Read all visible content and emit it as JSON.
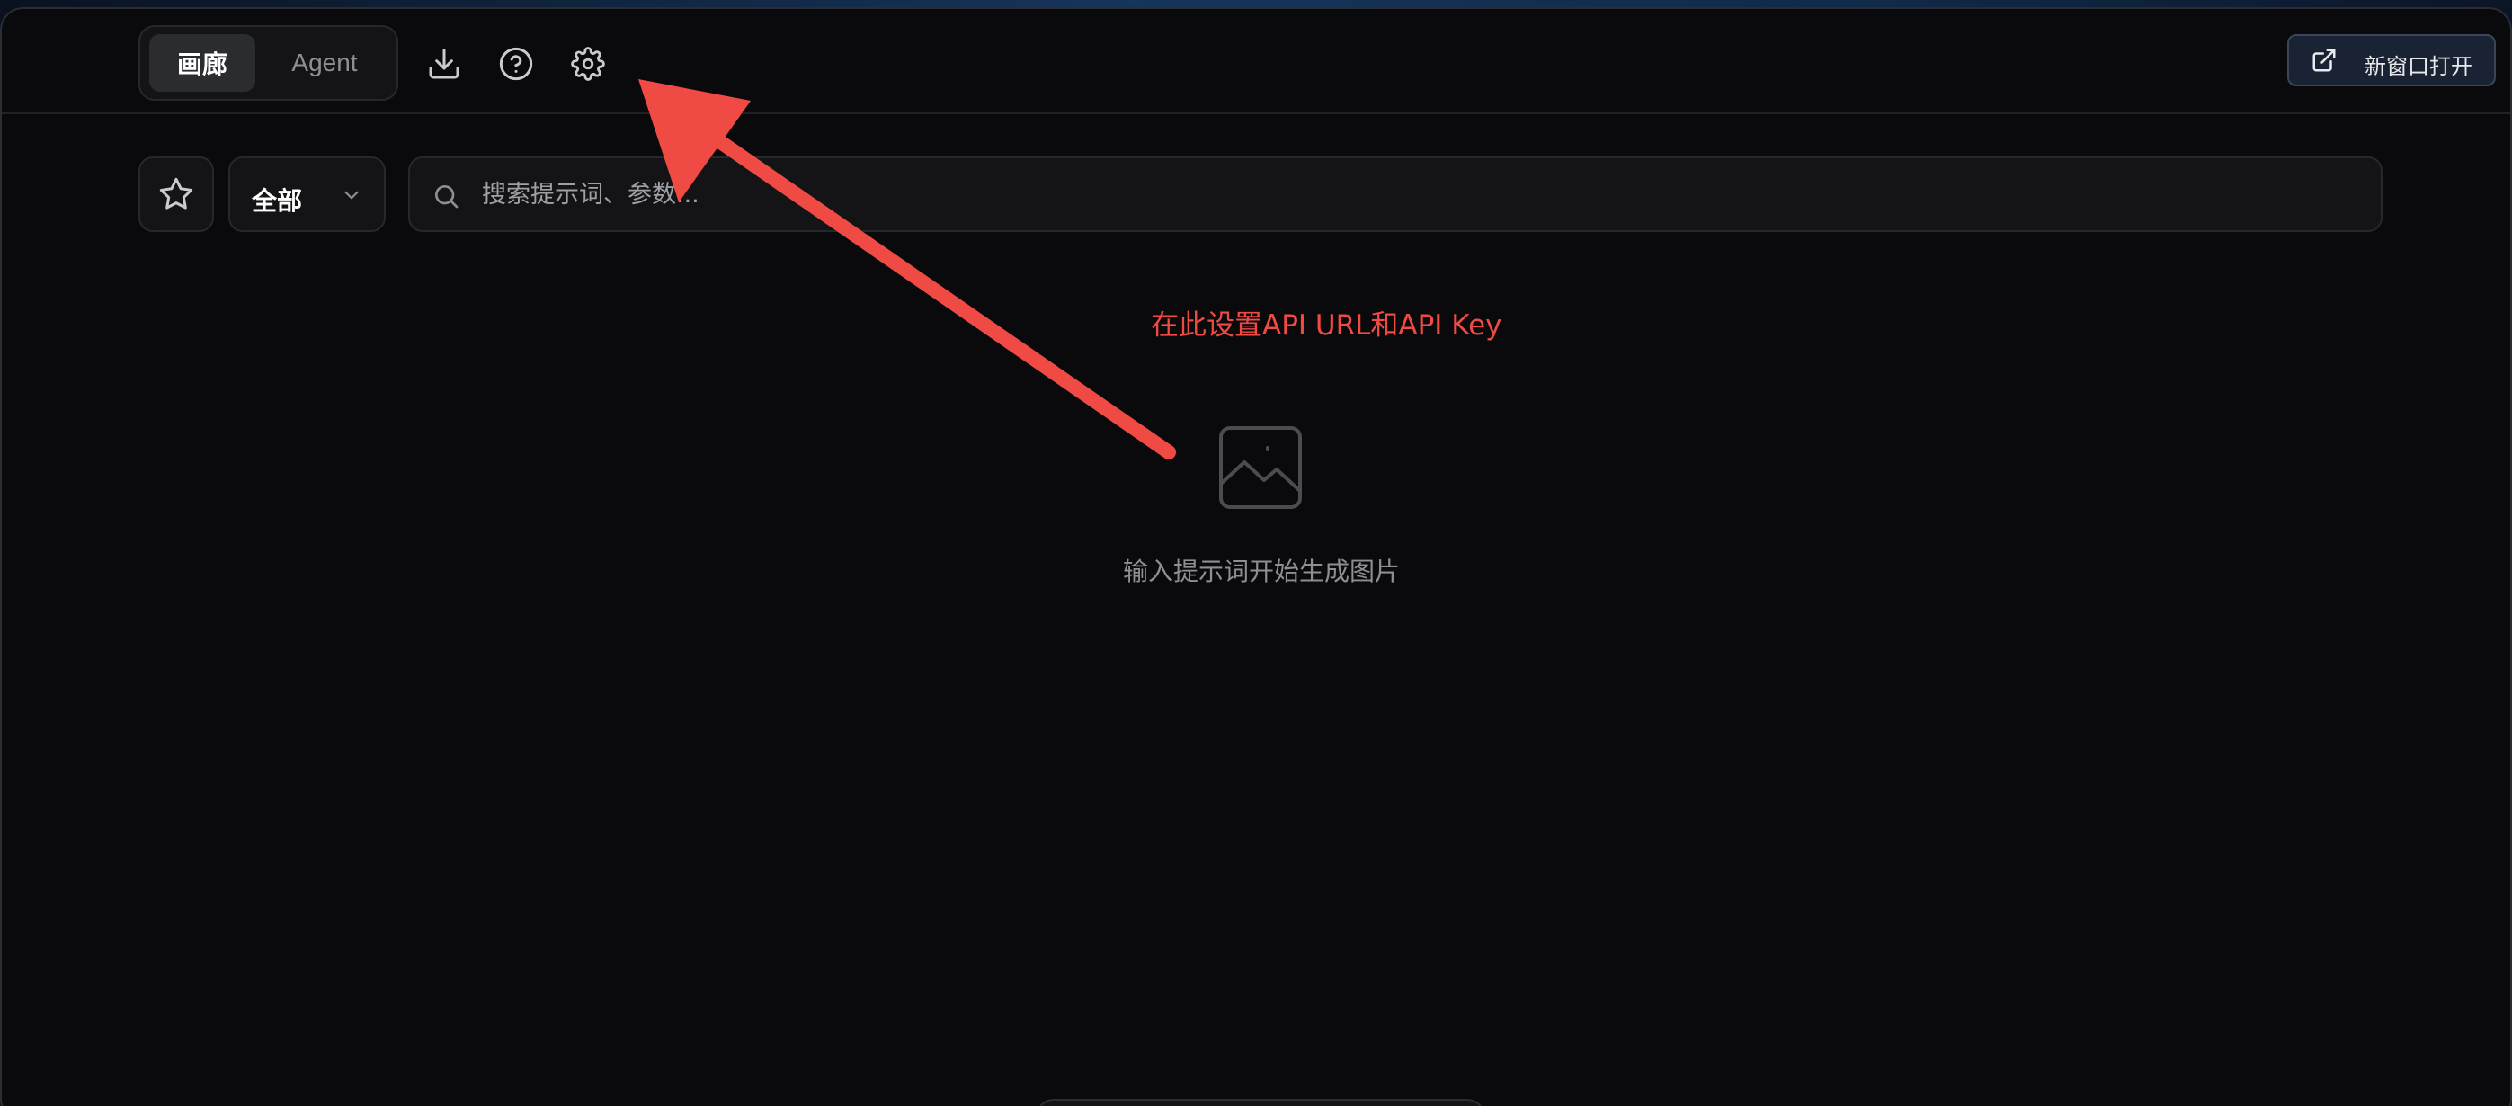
{
  "header": {
    "tabs": [
      {
        "label": "画廊",
        "active": true
      },
      {
        "label": "Agent",
        "active": false
      }
    ],
    "icons": [
      "download-icon",
      "help-circle-icon",
      "settings-icon"
    ],
    "open_new_window_label": "新窗口打开"
  },
  "filters": {
    "favorites_icon": "star-icon",
    "category_selected": "全部",
    "search_placeholder": "搜索提示词、参数..."
  },
  "annotation": {
    "text": "在此设置API URL和API Key",
    "color": "#f04a44"
  },
  "empty_state": {
    "icon": "image-icon",
    "text": "输入提示词开始生成图片"
  }
}
